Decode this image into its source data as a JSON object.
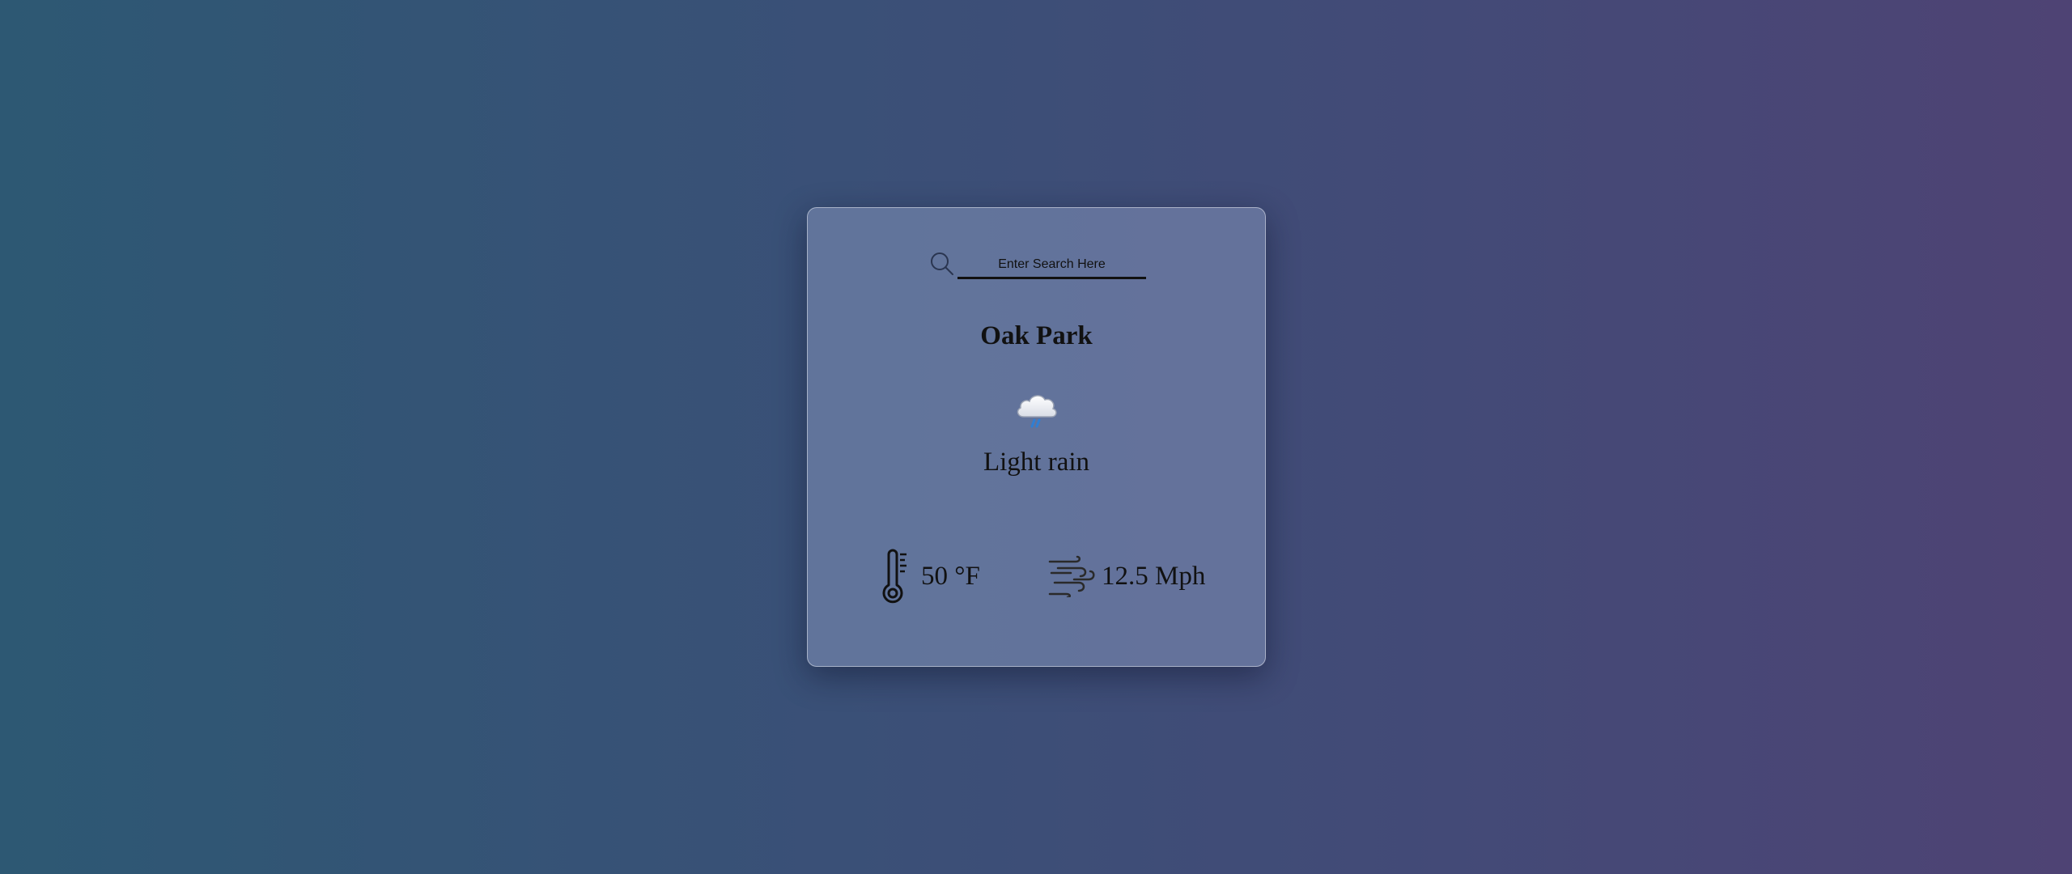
{
  "search": {
    "placeholder": "Enter Search Here",
    "icon": "search-icon"
  },
  "location": {
    "city": "Oak Park"
  },
  "weather": {
    "icon": "cloud-rain-icon",
    "description": "Light rain",
    "temperature": "50 °F",
    "temperature_icon": "thermometer-icon",
    "wind": "12.5 Mph",
    "wind_icon": "wind-icon"
  },
  "colors": {
    "background_start": "#2d5873",
    "background_end": "#4e4374",
    "card": "#6a7aa3",
    "text": "#111111",
    "rain_accent": "#2f7fd4"
  }
}
